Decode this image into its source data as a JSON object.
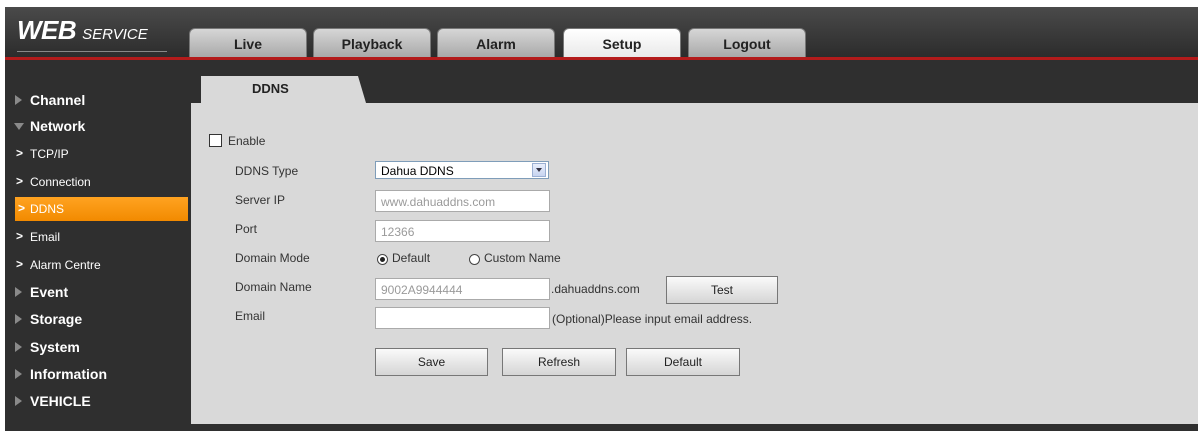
{
  "header": {
    "logo_main": "WEB",
    "logo_sub": "SERVICE",
    "tabs": [
      {
        "label": "Live"
      },
      {
        "label": "Playback"
      },
      {
        "label": "Alarm"
      },
      {
        "label": "Setup"
      },
      {
        "label": "Logout"
      }
    ],
    "active_tab": "Setup"
  },
  "sidebar": {
    "items": [
      {
        "label": "Channel"
      },
      {
        "label": "Network"
      },
      {
        "label": "TCP/IP"
      },
      {
        "label": "Connection"
      },
      {
        "label": "DDNS"
      },
      {
        "label": "Email"
      },
      {
        "label": "Alarm Centre"
      },
      {
        "label": "Event"
      },
      {
        "label": "Storage"
      },
      {
        "label": "System"
      },
      {
        "label": "Information"
      },
      {
        "label": "VEHICLE"
      }
    ],
    "active_item": "DDNS"
  },
  "page": {
    "subtab": "DDNS",
    "enable": {
      "label": "Enable",
      "checked": false
    },
    "ddns_type": {
      "label": "DDNS Type",
      "value": "Dahua DDNS"
    },
    "server_ip": {
      "label": "Server IP",
      "value": "www.dahuaddns.com"
    },
    "port": {
      "label": "Port",
      "value": "12366"
    },
    "domain_mode": {
      "label": "Domain Mode",
      "options": [
        "Default",
        "Custom Name"
      ],
      "selected": "Default"
    },
    "domain_name": {
      "label": "Domain Name",
      "value": "9002A9944444",
      "suffix": ".dahuaddns.com",
      "test_label": "Test"
    },
    "email": {
      "label": "Email",
      "value": "",
      "hint": "(Optional)Please input email address."
    },
    "buttons": {
      "save": "Save",
      "refresh": "Refresh",
      "default": "Default"
    }
  },
  "colors": {
    "accent": "#f28a00",
    "header_bar": "#b31b1b",
    "background": "#2f2f2f",
    "panel": "#d9d9d9"
  }
}
